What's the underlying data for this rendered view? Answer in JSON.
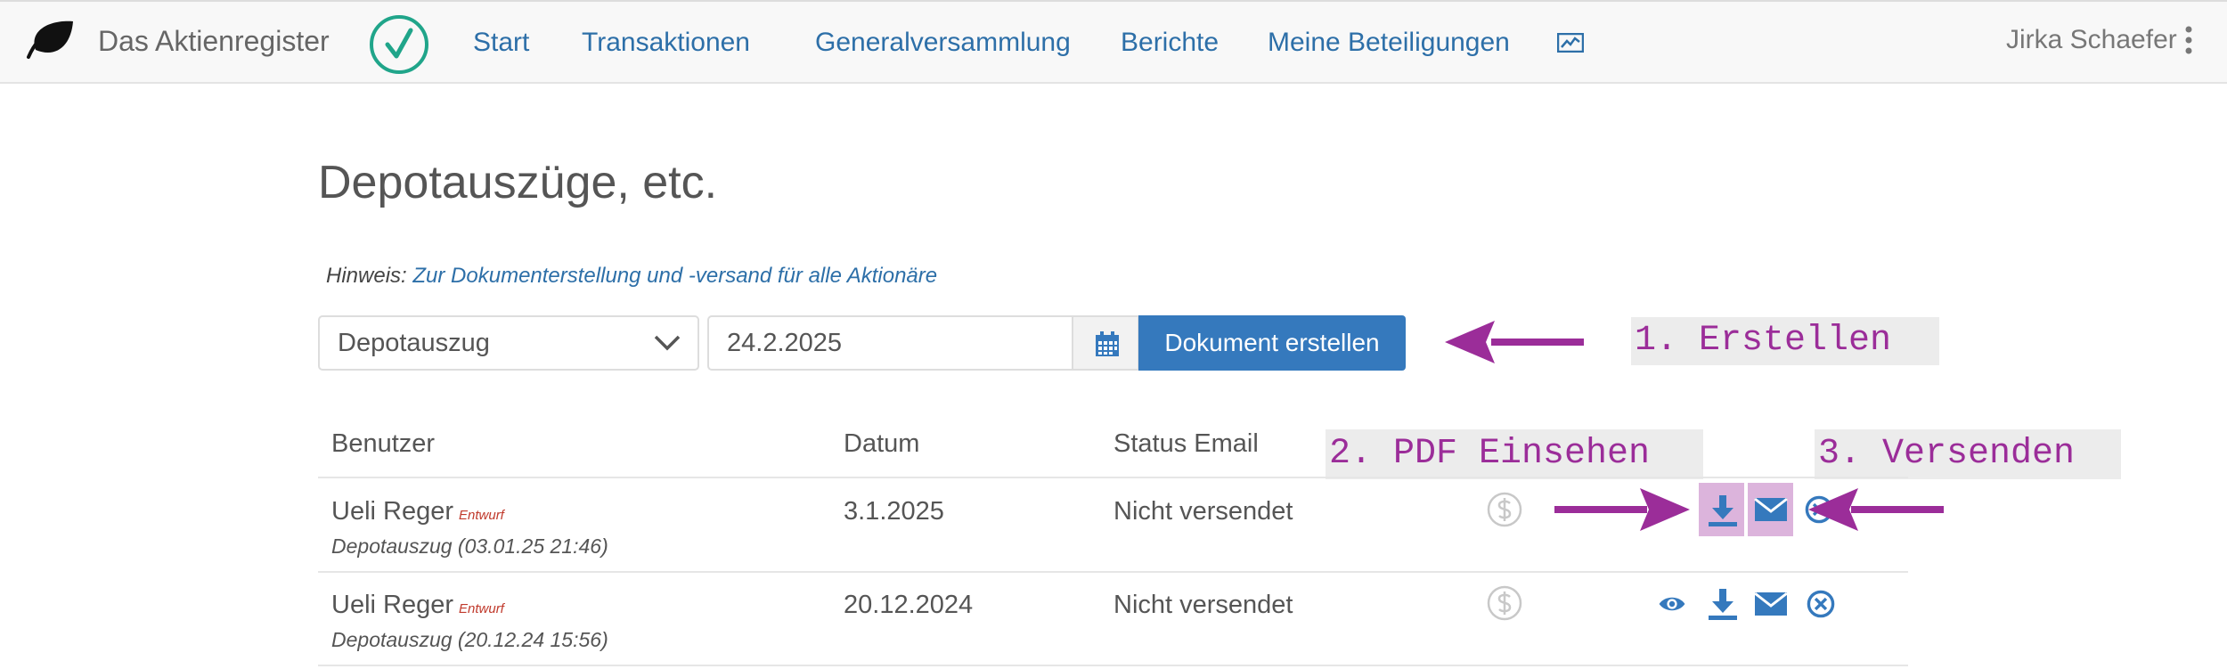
{
  "navbar": {
    "brand": "Das Aktienregister",
    "links": [
      "Start",
      "Transaktionen",
      "Generalversammlung",
      "Berichte",
      "Meine Beteiligungen"
    ],
    "user": "Jirka Schaefer"
  },
  "page": {
    "title": "Depotauszüge, etc.",
    "hint_prefix": "Hinweis:",
    "hint_link": "Zur Dokumenterstellung und -versand für alle Aktionäre"
  },
  "form": {
    "document_type": "Depotauszug",
    "date": "24.2.2025",
    "create_label": "Dokument erstellen"
  },
  "annotations": {
    "step1": "1. Erstellen",
    "step2": "2. PDF Einsehen",
    "step3": "3. Versenden"
  },
  "table": {
    "headers": [
      "Benutzer",
      "Datum",
      "Status Email"
    ],
    "rows": [
      {
        "user": "Ueli Reger",
        "badge": "Entwurf",
        "doc": "Depotauszug (03.01.25 21:46)",
        "date": "3.1.2025",
        "status": "Nicht versendet"
      },
      {
        "user": "Ueli Reger",
        "badge": "Entwurf",
        "doc": "Depotauszug (20.12.24 15:56)",
        "date": "20.12.2024",
        "status": "Nicht versendet"
      }
    ]
  },
  "colors": {
    "link": "#2d6fa8",
    "primary": "#3579bd",
    "annotation": "#9b2d99",
    "highlight": "#dcb4dc",
    "check": "#20a58a"
  }
}
